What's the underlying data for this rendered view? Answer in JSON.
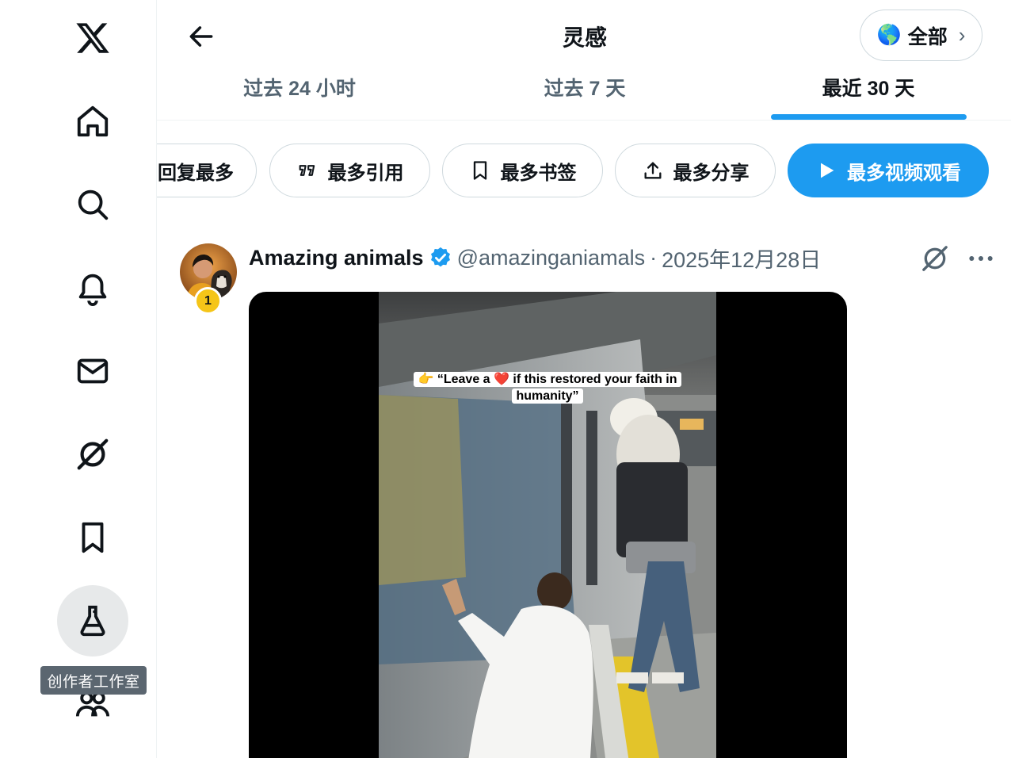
{
  "sidebar": {
    "items": [
      {
        "icon": "x-logo-icon"
      },
      {
        "icon": "home-icon"
      },
      {
        "icon": "search-icon"
      },
      {
        "icon": "bell-icon"
      },
      {
        "icon": "mail-icon"
      },
      {
        "icon": "grok-icon"
      },
      {
        "icon": "bookmark-icon"
      },
      {
        "icon": "flask-icon",
        "active": true
      },
      {
        "icon": "communities-icon"
      }
    ],
    "tooltip": "创作者工作室"
  },
  "header": {
    "title": "灵感",
    "region": {
      "flag": "🌎",
      "label": "全部",
      "chevron": "›"
    },
    "tabs": [
      {
        "label": "过去 24 小时",
        "active": false
      },
      {
        "label": "过去 7 天",
        "active": false
      },
      {
        "label": "最近 30 天",
        "active": true
      }
    ]
  },
  "filters": [
    {
      "label": "回复最多",
      "icon": ""
    },
    {
      "label": "最多引用",
      "icon": "quote-icon"
    },
    {
      "label": "最多书签",
      "icon": "bookmark-icon"
    },
    {
      "label": "最多分享",
      "icon": "share-icon"
    },
    {
      "label": "最多视频观看",
      "icon": "play-icon",
      "selected": true
    }
  ],
  "post": {
    "rank": "1",
    "author": "Amazing animals",
    "verified": true,
    "handle": "@amazinganiamals",
    "separator": "·",
    "date": "2025年12月28日",
    "video_caption_line1": "👉 “Leave a ❤️ if this restored your faith in",
    "video_caption_line2": "humanity”"
  },
  "colors": {
    "accent": "#1d9bf0",
    "text_primary": "#0f1419",
    "text_secondary": "#536471",
    "border": "#cfd9de",
    "badge": "#f5c518"
  }
}
